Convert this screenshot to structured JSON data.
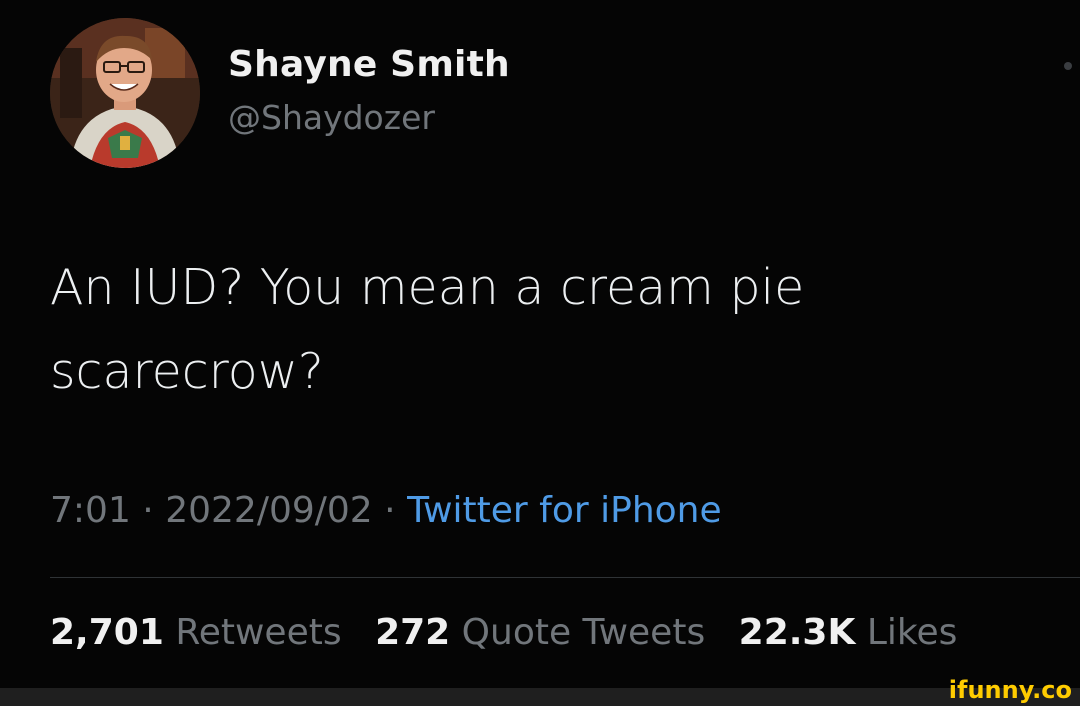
{
  "author": {
    "name": "Shayne Smith",
    "handle": "@Shaydozer"
  },
  "tweet": {
    "text_lines": [
      "An IUD? You mean a cream pie",
      "scarecrow?"
    ],
    "time": "7:01",
    "date": "2022/09/02",
    "source": "Twitter for iPhone",
    "separator": "·"
  },
  "stats": {
    "retweets_count": "2,701",
    "retweets_label": "Retweets",
    "quotes_count": "272",
    "quotes_label": "Quote Tweets",
    "likes_count": "22.3K",
    "likes_label": "Likes"
  },
  "watermark": "ifunny.co",
  "colors": {
    "background": "#000000",
    "text": "#eceff1",
    "muted": "#71767b",
    "link": "#4f9be6",
    "watermark": "#ffcc00"
  },
  "icons": {
    "avatar": "profile-photo",
    "more": "more-dot-icon"
  }
}
